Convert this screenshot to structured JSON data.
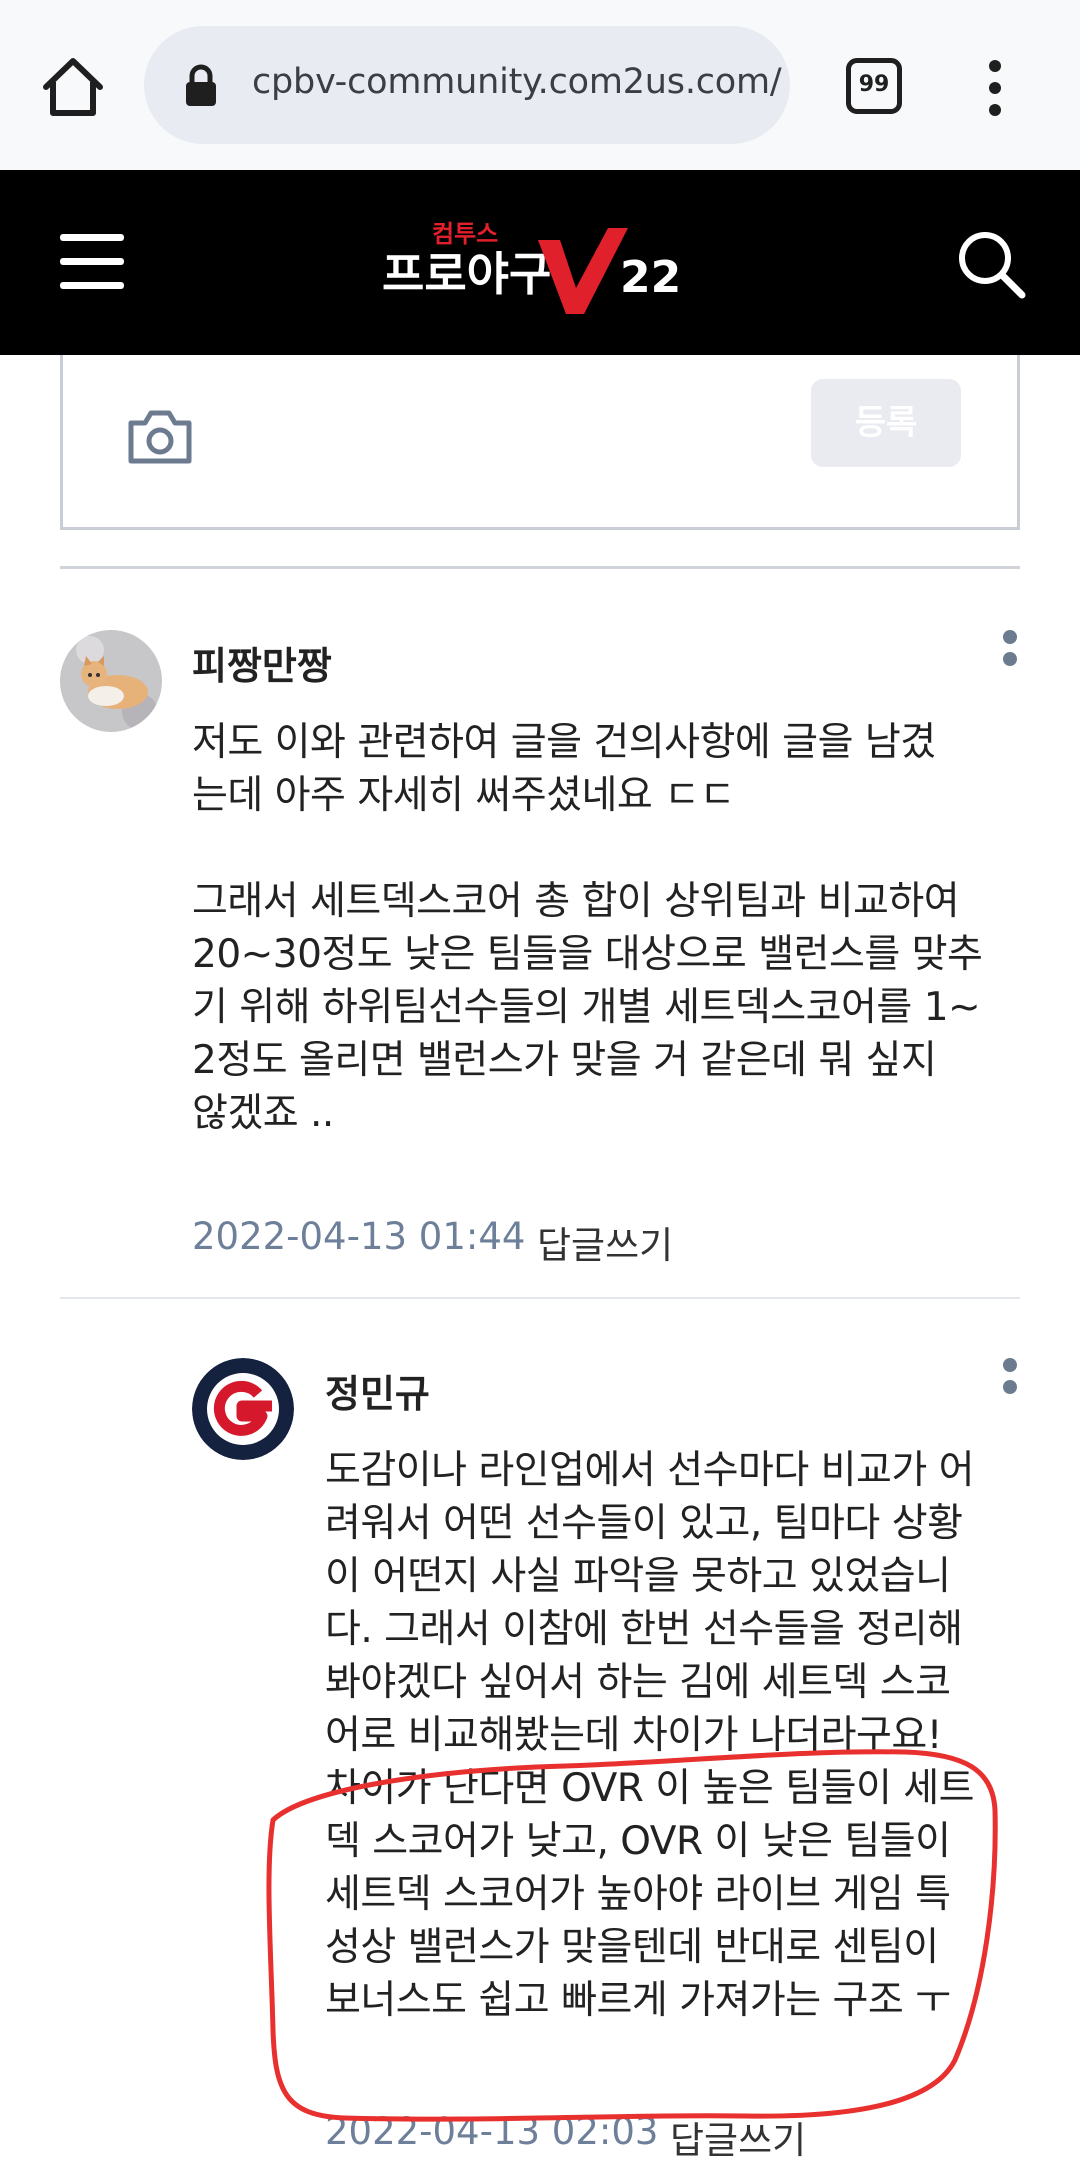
{
  "browser": {
    "url": "cpbv-community.com2us.com/",
    "tab_count": "99"
  },
  "site": {
    "logo_top": "컴투스",
    "logo_main": "프로야구",
    "logo_v": "V",
    "logo_num": "22"
  },
  "comment_form": {
    "submit_label": "등록"
  },
  "comments": [
    {
      "author": "피짱만짱",
      "body": "저도 이와 관련하여 글을 건의사항에 글을 남겼\n는데 아주 자세히 써주셨네요 ㄷㄷ\n\n그래서 세트덱스코어 총 합이 상위팀과 비교하여\n20~30정도 낮은 팀들을 대상으로 밸런스를 맞추\n기 위해 하위팀선수들의 개별 세트덱스코어를 1~\n2정도 올리면 밸런스가 맞을 거 같은데 뭐 싶지\n않겠죠 ..",
      "timestamp": "2022-04-13 01:44",
      "reply_label": "답글쓰기"
    },
    {
      "author": "정민규",
      "body": "도감이나 라인업에서 선수마다 비교가 어\n려워서 어떤 선수들이 있고, 팀마다 상황\n이 어떤지 사실 파악을 못하고 있었습니\n다. 그래서 이참에 한번 선수들을 정리해\n봐야겠다 싶어서 하는 김에 세트덱 스코\n어로 비교해봤는데 차이가 나더라구요!\n차이가 난다면 OVR 이 높은 팀들이 세트\n덱 스코어가 낮고, OVR 이 낮은 팀들이\n세트덱 스코어가 높아야 라이브 게임 특\n성상 밸런스가 맞을텐데 반대로 센팀이\n보너스도 쉽고 빠르게 가져가는 구조 ㅜ",
      "timestamp": "2022-04-13 02:03",
      "reply_label": "답글쓰기"
    }
  ],
  "colors": {
    "header_bg": "#000000",
    "logo_red": "#e0202a",
    "timestamp": "#6e7f99",
    "annotation_red": "#e8302f"
  }
}
